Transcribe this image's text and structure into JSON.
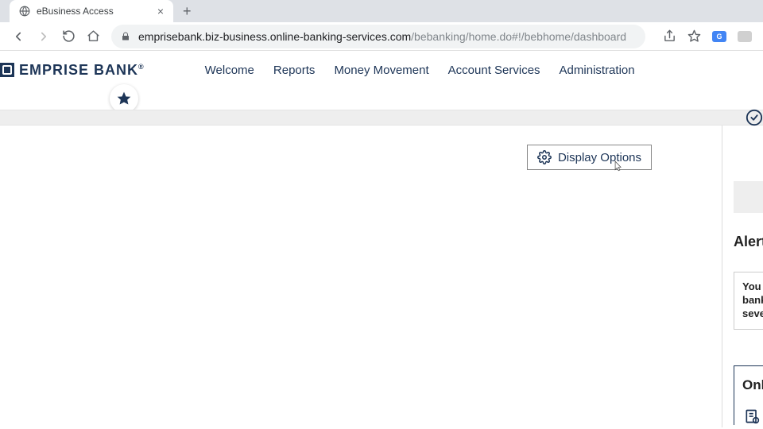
{
  "browser": {
    "tab_title": "eBusiness Access",
    "url_host": "emprisebank.biz-business.online-banking-services.com",
    "url_path": "/bebanking/home.do#!/bebhome/dashboard"
  },
  "brand": {
    "name": "EMPRISE BANK"
  },
  "nav": {
    "items": [
      "Welcome",
      "Reports",
      "Money Movement",
      "Account Services",
      "Administration"
    ]
  },
  "main": {
    "display_options_label": "Display Options"
  },
  "sidebar": {
    "alerts_heading": "Alerts",
    "alert_text_line1": "You",
    "alert_text_line2": "bank",
    "alert_text_line3": "seve",
    "online_heading": "Onli"
  }
}
